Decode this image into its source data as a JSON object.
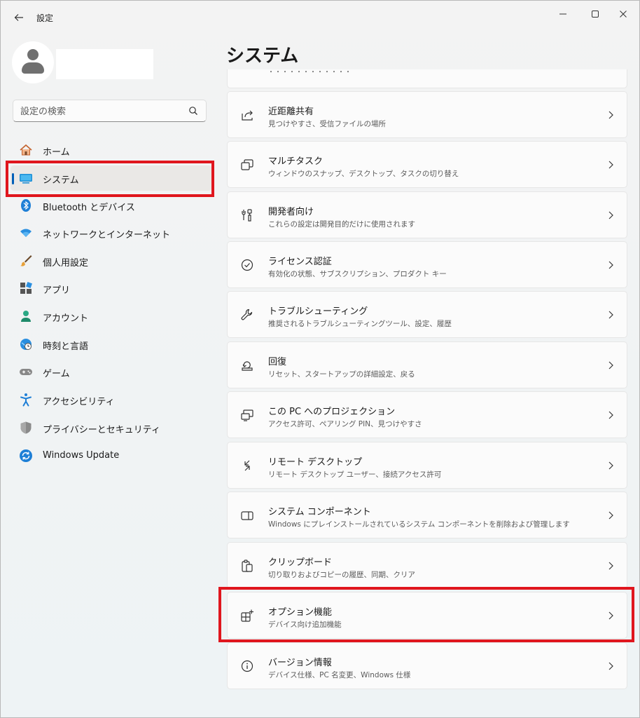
{
  "window": {
    "app_title": "設定",
    "back_icon": "←",
    "min_icon": "—",
    "max_icon": "☐",
    "close_icon": "✕"
  },
  "sidebar": {
    "search_placeholder": "設定の検索",
    "items": [
      {
        "label": "ホーム",
        "icon": "home-icon"
      },
      {
        "label": "システム",
        "icon": "system-icon",
        "selected": true
      },
      {
        "label": "Bluetooth とデバイス",
        "icon": "bluetooth-icon"
      },
      {
        "label": "ネットワークとインターネット",
        "icon": "wifi-icon"
      },
      {
        "label": "個人用設定",
        "icon": "brush-icon"
      },
      {
        "label": "アプリ",
        "icon": "apps-icon"
      },
      {
        "label": "アカウント",
        "icon": "account-icon"
      },
      {
        "label": "時刻と言語",
        "icon": "time-language-icon"
      },
      {
        "label": "ゲーム",
        "icon": "gamepad-icon"
      },
      {
        "label": "アクセシビリティ",
        "icon": "accessibility-icon"
      },
      {
        "label": "プライバシーとセキュリティ",
        "icon": "shield-icon"
      },
      {
        "label": "Windows Update",
        "icon": "update-icon"
      }
    ]
  },
  "main": {
    "title": "システム",
    "partial_card_text": "・・・・・・・・・・・・",
    "cards": [
      {
        "title": "近距離共有",
        "subtitle": "見つけやすさ、受信ファイルの場所",
        "icon": "share-icon"
      },
      {
        "title": "マルチタスク",
        "subtitle": "ウィンドウのスナップ、デスクトップ、タスクの切り替え",
        "icon": "multitask-icon"
      },
      {
        "title": "開発者向け",
        "subtitle": "これらの設定は開発目的だけに使用されます",
        "icon": "developer-icon"
      },
      {
        "title": "ライセンス認証",
        "subtitle": "有効化の状態、サブスクリプション、プロダクト キー",
        "icon": "activation-icon"
      },
      {
        "title": "トラブルシューティング",
        "subtitle": "推奨されるトラブルシューティングツール、設定、履歴",
        "icon": "wrench-icon"
      },
      {
        "title": "回復",
        "subtitle": "リセット、スタートアップの詳細設定、戻る",
        "icon": "recovery-icon"
      },
      {
        "title": "この PC へのプロジェクション",
        "subtitle": "アクセス許可、ペアリング PIN、見つけやすさ",
        "icon": "projection-icon"
      },
      {
        "title": "リモート デスクトップ",
        "subtitle": "リモート デスクトップ ユーザー、接続アクセス許可",
        "icon": "remote-desktop-icon"
      },
      {
        "title": "システム コンポーネント",
        "subtitle": "Windows にプレインストールされているシステム コンポーネントを削除および管理します",
        "icon": "component-icon"
      },
      {
        "title": "クリップボード",
        "subtitle": "切り取りおよびコピーの履歴、同期、クリア",
        "icon": "clipboard-icon"
      },
      {
        "title": "オプション機能",
        "subtitle": "デバイス向け追加機能",
        "icon": "optional-features-icon"
      },
      {
        "title": "バージョン情報",
        "subtitle": "デバイス仕様、PC 名変更、Windows 仕様",
        "icon": "info-icon"
      }
    ]
  },
  "colors": {
    "accent": "#005fb8",
    "highlight_box": "#e0161e"
  }
}
